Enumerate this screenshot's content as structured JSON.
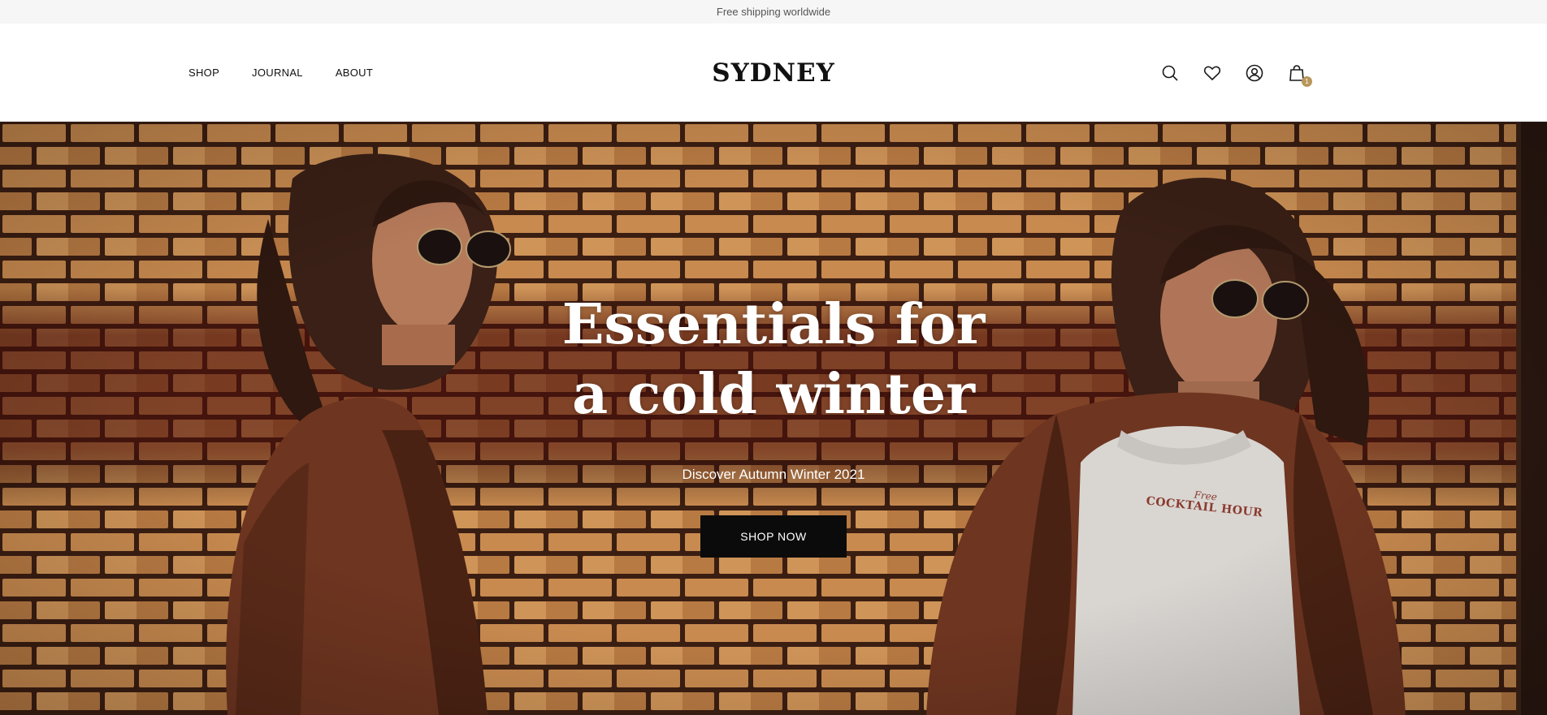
{
  "announcement": {
    "text": "Free shipping worldwide"
  },
  "header": {
    "nav": [
      {
        "label": "SHOP"
      },
      {
        "label": "JOURNAL"
      },
      {
        "label": "ABOUT"
      }
    ],
    "logo": "SYDNEY",
    "icons": [
      "search-icon",
      "heart-icon",
      "account-icon",
      "cart-icon"
    ],
    "cart_count": "1"
  },
  "hero": {
    "headline_line1": "Essentials for",
    "headline_line2": "a cold winter",
    "subtitle": "Discover Autumn Winter 2021",
    "cta_label": "SHOP NOW",
    "sweatshirt_print": "COCKTAIL HOUR",
    "sweatshirt_script": "Free"
  },
  "colors": {
    "accent": "#b9975b",
    "button_bg": "#0b0b0b",
    "announcement_bg": "#f6f6f6",
    "brick": "#c88a4f",
    "mortar": "#3b1e12",
    "coat": "#6e3520"
  }
}
